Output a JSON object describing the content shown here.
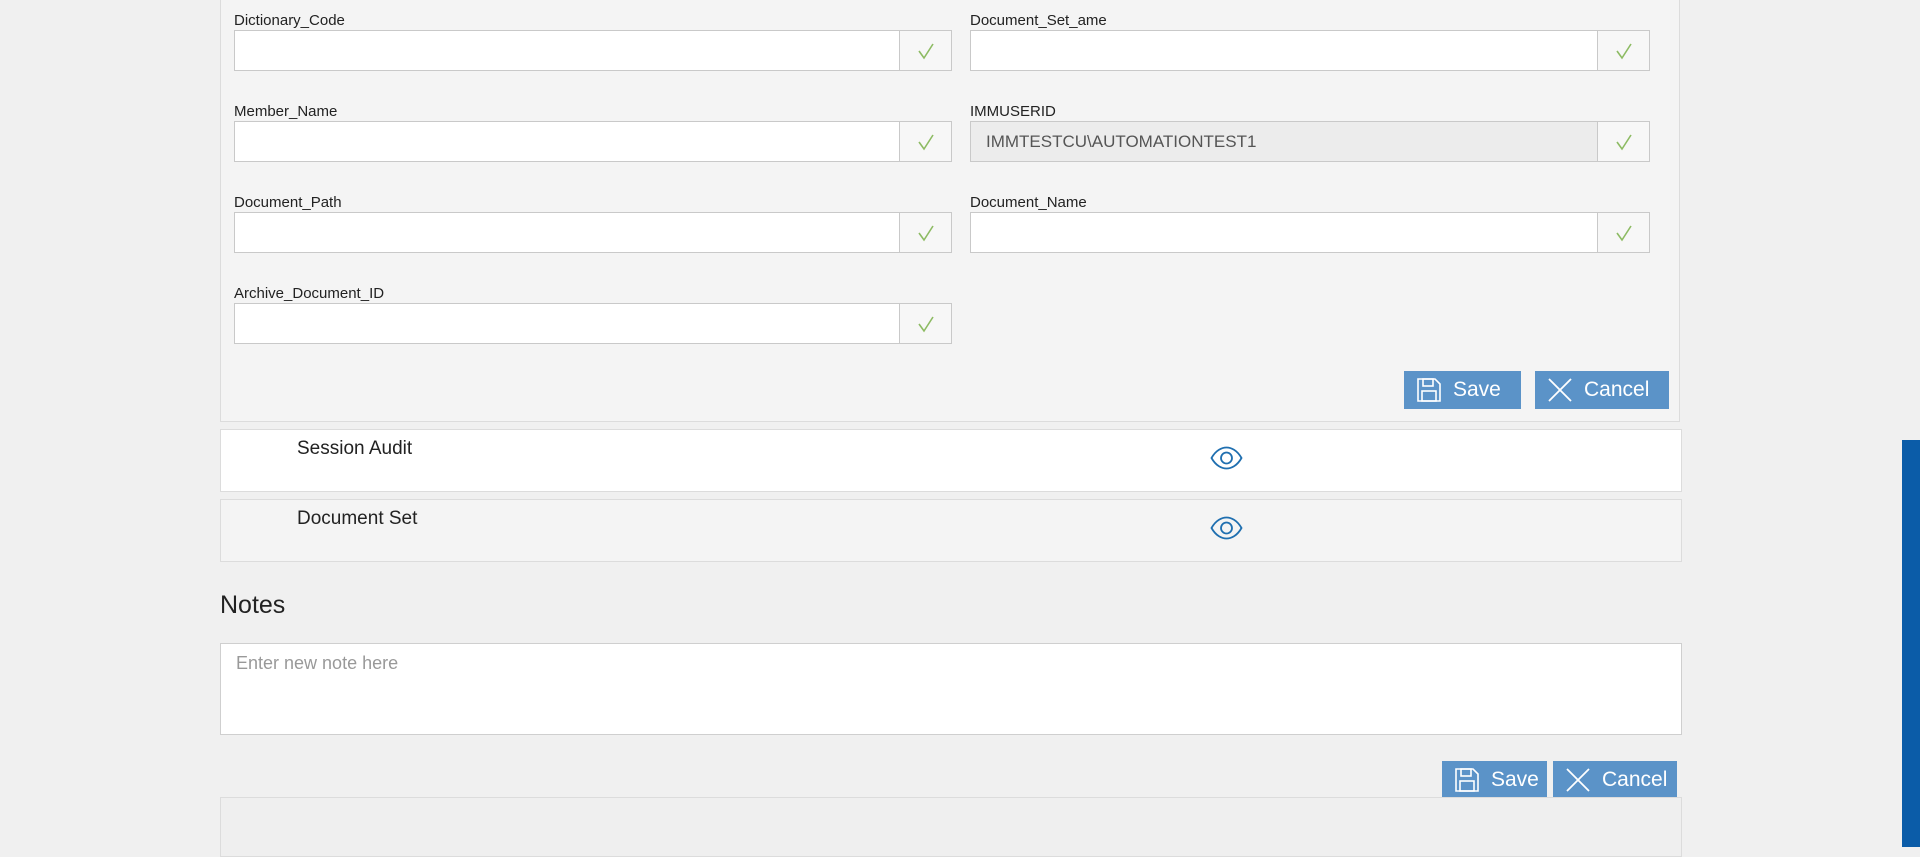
{
  "fields": [
    {
      "id": "dictionary-code",
      "label": "Dictionary_Code",
      "value": ""
    },
    {
      "id": "document-set-ame",
      "label": "Document_Set_ame",
      "value": ""
    },
    {
      "id": "member-name",
      "label": "Member_Name",
      "value": ""
    },
    {
      "id": "immuserid",
      "label": "IMMUSERID",
      "value": "IMMTESTCU\\AUTOMATIONTEST1"
    },
    {
      "id": "document-path",
      "label": "Document_Path",
      "value": ""
    },
    {
      "id": "document-name",
      "label": "Document_Name",
      "value": ""
    },
    {
      "id": "archive-document-id",
      "label": "Archive_Document_ID",
      "value": ""
    }
  ],
  "form_actions": {
    "save_label": "Save",
    "cancel_label": "Cancel"
  },
  "sections": [
    {
      "title": "Session Audit",
      "icon": "eye-icon"
    },
    {
      "title": "Document Set",
      "icon": "eye-icon"
    }
  ],
  "notes": {
    "heading": "Notes",
    "placeholder": "Enter new note here",
    "save_label": "Save",
    "cancel_label": "Cancel"
  },
  "icons": {
    "check": "check-icon",
    "save": "save-icon",
    "cancel": "close-icon",
    "view": "eye-icon"
  },
  "colors": {
    "button_bg": "#5b93c8",
    "check": "#8dbb63",
    "eye": "#1f6fb0",
    "scrollbar": "#0b5ca8",
    "page_bg": "#f0f0f0"
  }
}
